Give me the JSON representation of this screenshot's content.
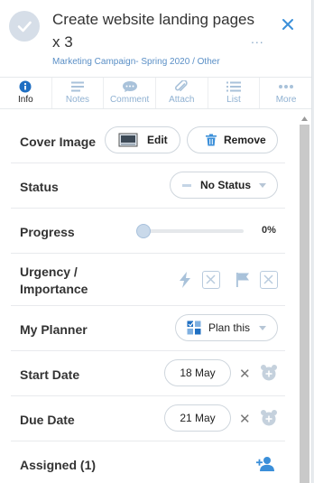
{
  "task": {
    "title": "Create website landing pages x 3",
    "breadcrumb": "Marketing Campaign- Spring 2020 / Other",
    "more_glyph": "..."
  },
  "tabs": [
    {
      "label": "Info",
      "icon": "info-icon",
      "active": true
    },
    {
      "label": "Notes",
      "icon": "notes-icon",
      "active": false
    },
    {
      "label": "Comment",
      "icon": "comment-icon",
      "active": false
    },
    {
      "label": "Attach",
      "icon": "paperclip-icon",
      "active": false
    },
    {
      "label": "List",
      "icon": "list-icon",
      "active": false
    },
    {
      "label": "More",
      "icon": "more-dots-icon",
      "active": false
    }
  ],
  "fields": {
    "cover_image": {
      "label": "Cover Image",
      "edit": "Edit",
      "remove": "Remove"
    },
    "status": {
      "label": "Status",
      "value": "No Status"
    },
    "progress": {
      "label": "Progress",
      "value_text": "0%",
      "value": 0
    },
    "urgency": {
      "label_line1": "Urgency /",
      "label_line2": "Importance"
    },
    "planner": {
      "label": "My Planner",
      "value": "Plan this"
    },
    "start_date": {
      "label": "Start Date",
      "value": "18 May"
    },
    "due_date": {
      "label": "Due Date",
      "value": "21 May"
    },
    "assigned": {
      "label": "Assigned (1)"
    }
  },
  "colors": {
    "accent": "#3b8fd9",
    "icon_muted": "#a9c2da",
    "link": "#5a8fc6"
  }
}
